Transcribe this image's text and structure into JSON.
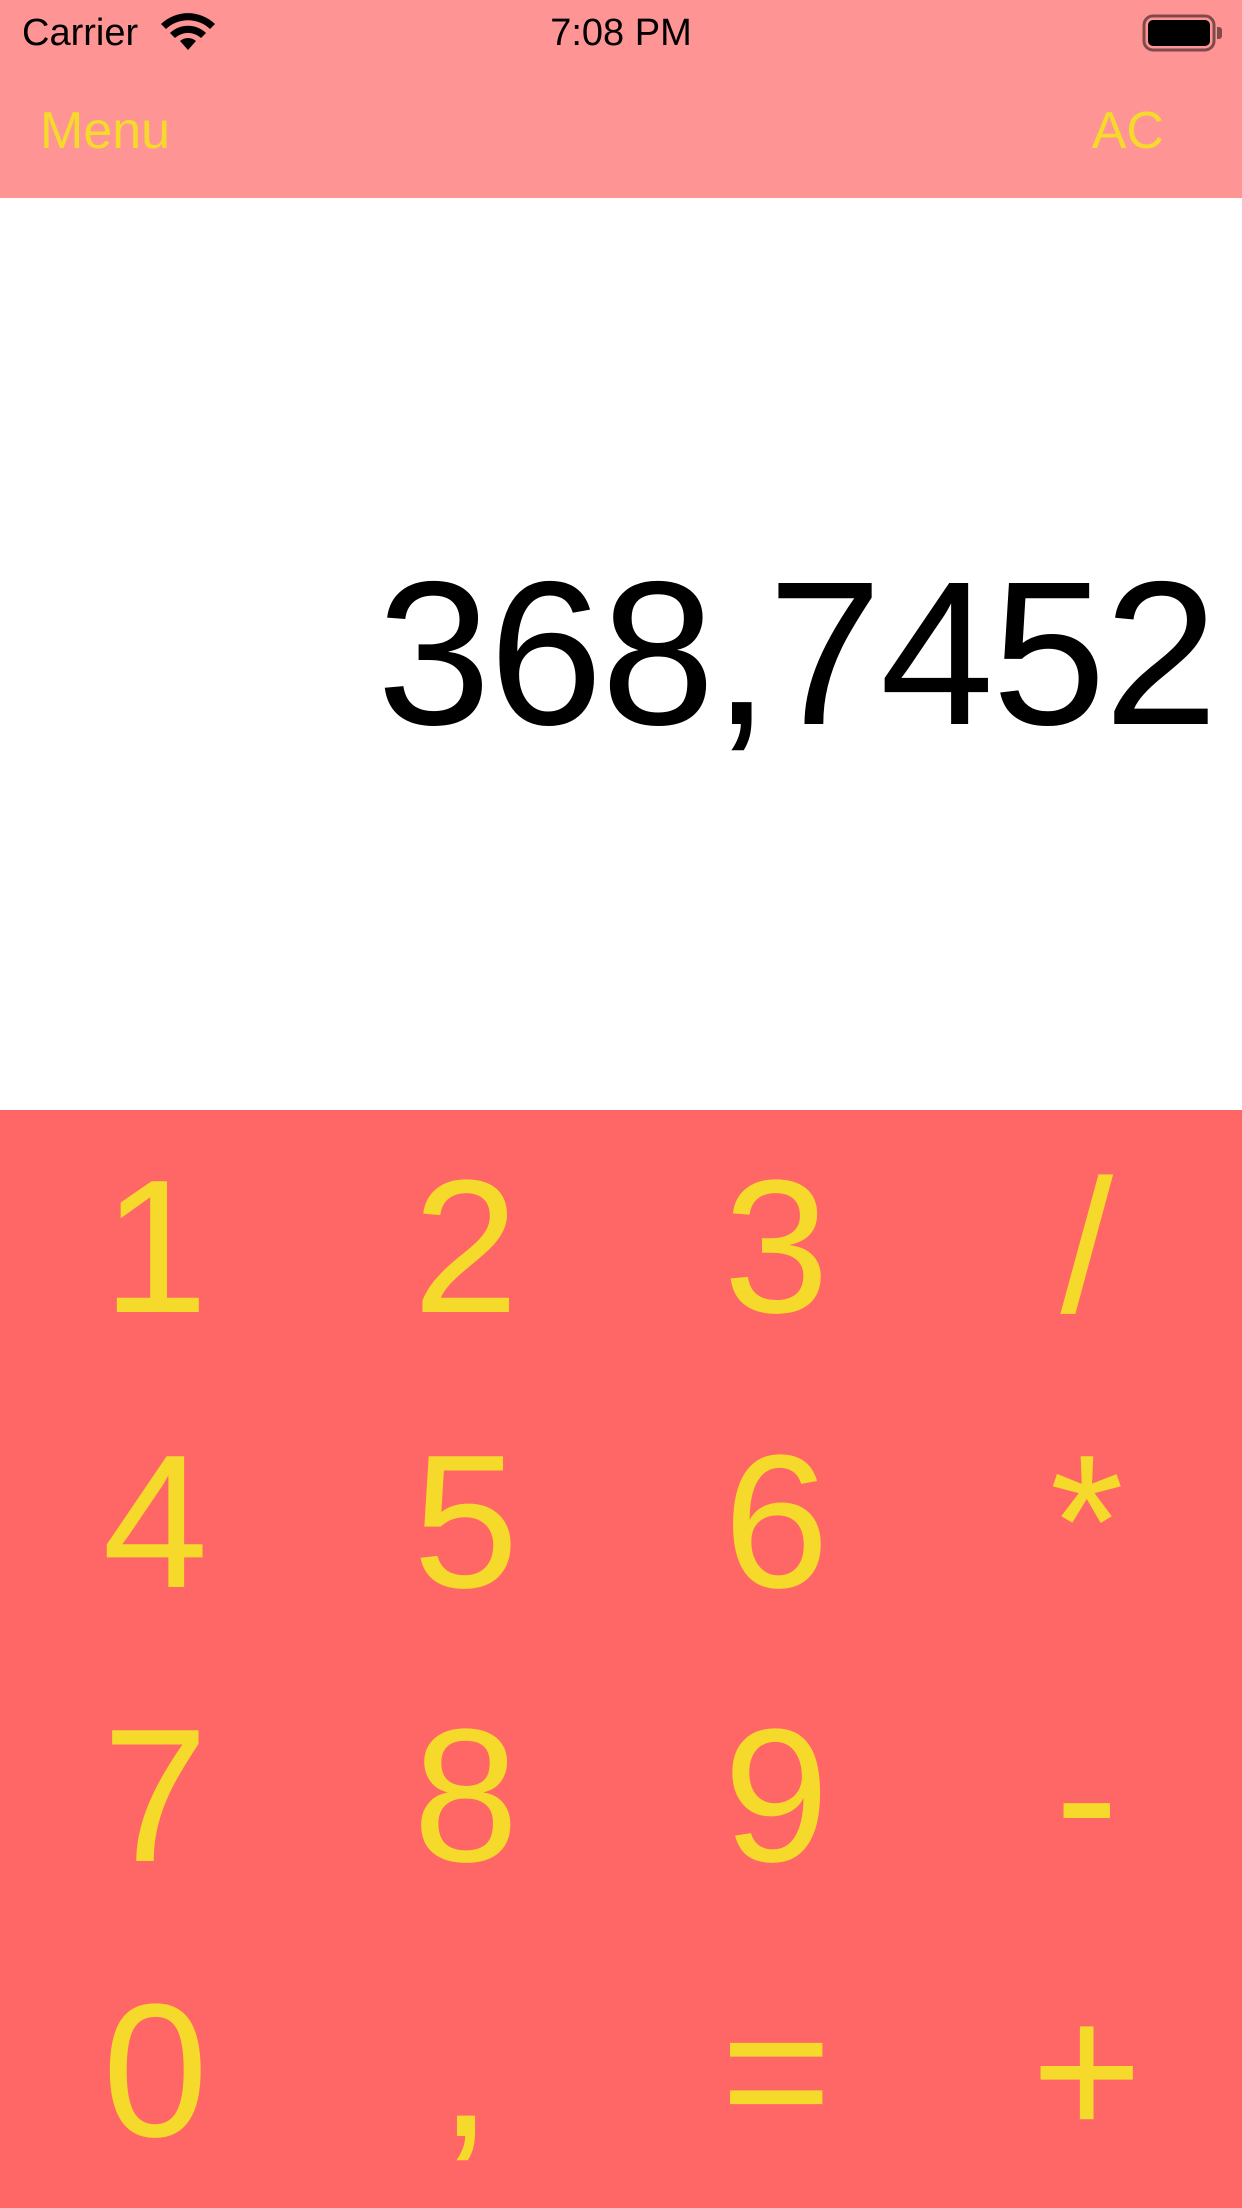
{
  "status_bar": {
    "carrier": "Carrier",
    "time": "7:08 PM",
    "wifi_icon": "wifi-icon",
    "battery_icon": "battery-icon"
  },
  "nav": {
    "left_label": "Menu",
    "right_label": "AC"
  },
  "display": {
    "value": "368,7452"
  },
  "keypad": {
    "keys": [
      "1",
      "2",
      "3",
      "/",
      "4",
      "5",
      "6",
      "*",
      "7",
      "8",
      "9",
      "-",
      "0",
      ",",
      "=",
      "+"
    ]
  },
  "colors": {
    "header_bg": "#FF9494",
    "keypad_bg": "#FF6666",
    "key_text": "#F5DA2C",
    "display_bg": "#FFFFFF",
    "display_text": "#000000"
  }
}
